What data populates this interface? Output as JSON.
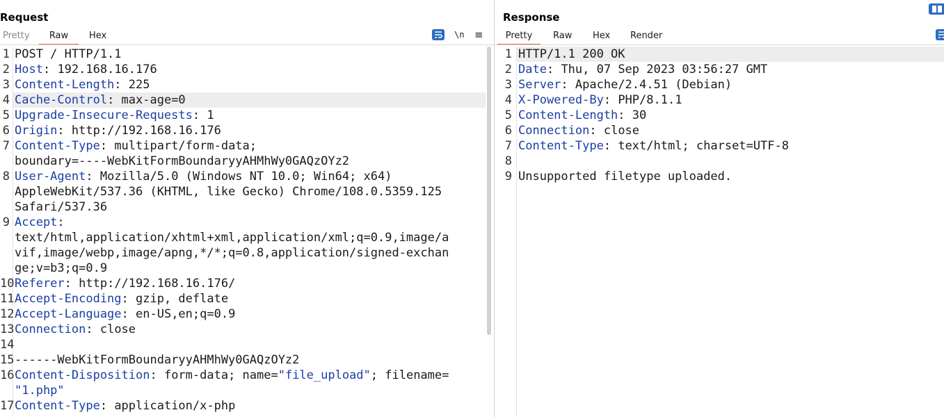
{
  "request": {
    "title": "Request",
    "tabs": [
      "Pretty",
      "Raw",
      "Hex"
    ],
    "active_tab": "Raw",
    "newline_label": "\\n",
    "menu_icon": "≡",
    "lines": [
      {
        "n": "1",
        "name": "",
        "sep": "",
        "value": "POST / HTTP/1.1"
      },
      {
        "n": "2",
        "name": "Host",
        "sep": ": ",
        "value": "192.168.16.176"
      },
      {
        "n": "3",
        "name": "Content-Length",
        "sep": ": ",
        "value": "225"
      },
      {
        "n": "4",
        "name": "Cache-Control",
        "sep": ": ",
        "value": "max-age=0"
      },
      {
        "n": "5",
        "name": "Upgrade-Insecure-Requests",
        "sep": ": ",
        "value": "1"
      },
      {
        "n": "6",
        "name": "Origin",
        "sep": ": ",
        "value": "http://192.168.16.176"
      },
      {
        "n": "7",
        "name": "Content-Type",
        "sep": ": ",
        "value": "multipart/form-data;"
      },
      {
        "n": "",
        "name": "",
        "sep": "",
        "value": "boundary=----WebKitFormBoundaryyAHMhWy0GAQzOYz2"
      },
      {
        "n": "8",
        "name": "User-Agent",
        "sep": ": ",
        "value": "Mozilla/5.0 (Windows NT 10.0; Win64; x64)"
      },
      {
        "n": "",
        "name": "",
        "sep": "",
        "value": "AppleWebKit/537.36 (KHTML, like Gecko) Chrome/108.0.5359.125"
      },
      {
        "n": "",
        "name": "",
        "sep": "",
        "value": "Safari/537.36"
      },
      {
        "n": "9",
        "name": "Accept",
        "sep": ":",
        "value": ""
      },
      {
        "n": "",
        "name": "",
        "sep": "",
        "value": "text/html,application/xhtml+xml,application/xml;q=0.9,image/a"
      },
      {
        "n": "",
        "name": "",
        "sep": "",
        "value": "vif,image/webp,image/apng,*/*;q=0.8,application/signed-exchan"
      },
      {
        "n": "",
        "name": "",
        "sep": "",
        "value": "ge;v=b3;q=0.9"
      },
      {
        "n": "10",
        "name": "Referer",
        "sep": ": ",
        "value": "http://192.168.16.176/"
      },
      {
        "n": "11",
        "name": "Accept-Encoding",
        "sep": ": ",
        "value": "gzip, deflate"
      },
      {
        "n": "12",
        "name": "Accept-Language",
        "sep": ": ",
        "value": "en-US,en;q=0.9"
      },
      {
        "n": "13",
        "name": "Connection",
        "sep": ": ",
        "value": "close"
      },
      {
        "n": "14",
        "name": "",
        "sep": "",
        "value": ""
      },
      {
        "n": "15",
        "name": "",
        "sep": "",
        "value": "------WebKitFormBoundaryyAHMhWy0GAQzOYz2"
      },
      {
        "n": "16",
        "name": "Content-Disposition",
        "sep": ": ",
        "value": "form-data; name=",
        "q1": "\"file_upload\"",
        "mid": "; filename="
      },
      {
        "n": "",
        "name": "",
        "sep": "",
        "value": "",
        "q1": "\"1.php\"",
        "mid": ""
      },
      {
        "n": "17",
        "name": "Content-Type",
        "sep": ": ",
        "value": "application/x-php"
      }
    ]
  },
  "response": {
    "title": "Response",
    "tabs": [
      "Pretty",
      "Raw",
      "Hex",
      "Render"
    ],
    "active_tab": "Pretty",
    "lines": [
      {
        "n": "1",
        "name": "",
        "sep": "",
        "value": "HTTP/1.1 200 OK"
      },
      {
        "n": "2",
        "name": "Date",
        "sep": ": ",
        "value": "Thu, 07 Sep 2023 03:56:27 GMT"
      },
      {
        "n": "3",
        "name": "Server",
        "sep": ": ",
        "value": "Apache/2.4.51 (Debian)"
      },
      {
        "n": "4",
        "name": "X-Powered-By",
        "sep": ": ",
        "value": "PHP/8.1.1"
      },
      {
        "n": "5",
        "name": "Content-Length",
        "sep": ": ",
        "value": "30"
      },
      {
        "n": "6",
        "name": "Connection",
        "sep": ": ",
        "value": "close"
      },
      {
        "n": "7",
        "name": "Content-Type",
        "sep": ": ",
        "value": "text/html; charset=UTF-8"
      },
      {
        "n": "8",
        "name": "",
        "sep": "",
        "value": ""
      },
      {
        "n": "9",
        "name": "",
        "sep": "",
        "value": "Unsupported filetype uploaded."
      }
    ]
  },
  "colors": {
    "header_name": "#1a3fa3",
    "active_tab_underline": "#e8663d",
    "button_blue": "#2b6cc0",
    "highlight_row": "#ededed"
  },
  "icons": [
    "wrap-lines-icon",
    "newline-icon",
    "hamburger-menu-icon",
    "layout-toggle-icon"
  ]
}
